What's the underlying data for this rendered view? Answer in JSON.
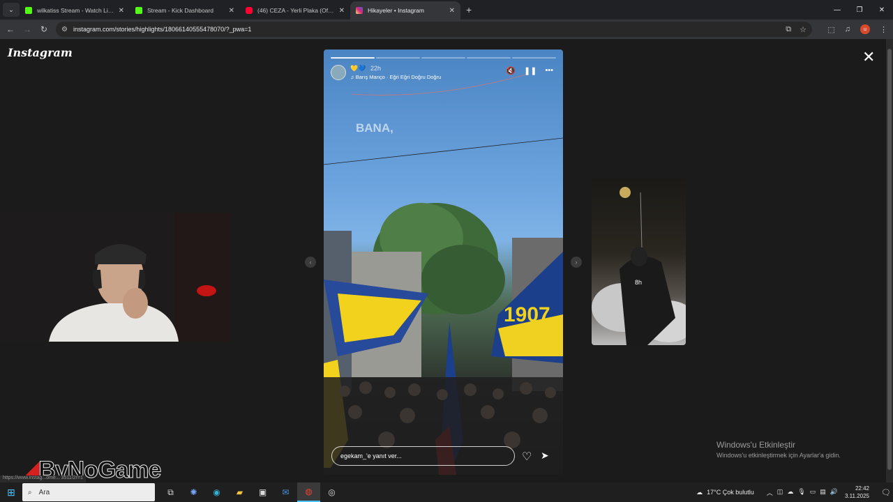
{
  "browser": {
    "tabs": [
      {
        "title": "wilkatiss Stream - Watch Live o",
        "favicon_color": "#53fc18",
        "active": false
      },
      {
        "title": "Stream - Kick Dashboard",
        "favicon_color": "#53fc18",
        "active": false
      },
      {
        "title": "(46) CEZA - Yerli Plaka (Official",
        "favicon_color": "#ff0033",
        "active": false
      },
      {
        "title": "Hikayeler • Instagram",
        "favicon_color": "#d6249f",
        "active": true
      }
    ],
    "url": "instagram.com/stories/highlights/18066140555478070/?_pwa=1",
    "profile_initial": "u"
  },
  "instagram": {
    "logo": "Instagram",
    "story": {
      "emoji": "💛💙",
      "time_ago": "22h",
      "music": "Barış Manço · Eğri Eğri Doğru Doğru",
      "overlay_text": "BANA,",
      "reply_placeholder": "egekam_'e yanıt ver...",
      "progress_total": 5,
      "progress_done": 1
    },
    "next_story_time": "8h"
  },
  "overlay": {
    "watermark": "ByNoGame",
    "status_url": "https://www.instag...ome... 3511/2r=1"
  },
  "windows_activation": {
    "title": "Windows'u Etkinleştir",
    "subtitle": "Windows'u etkinleştirmek için Ayarlar'a gidin."
  },
  "taskbar": {
    "search_placeholder": "Ara",
    "weather": "17°C  Çok bulutlu",
    "time": "22:42",
    "date": "3.11.2025"
  }
}
